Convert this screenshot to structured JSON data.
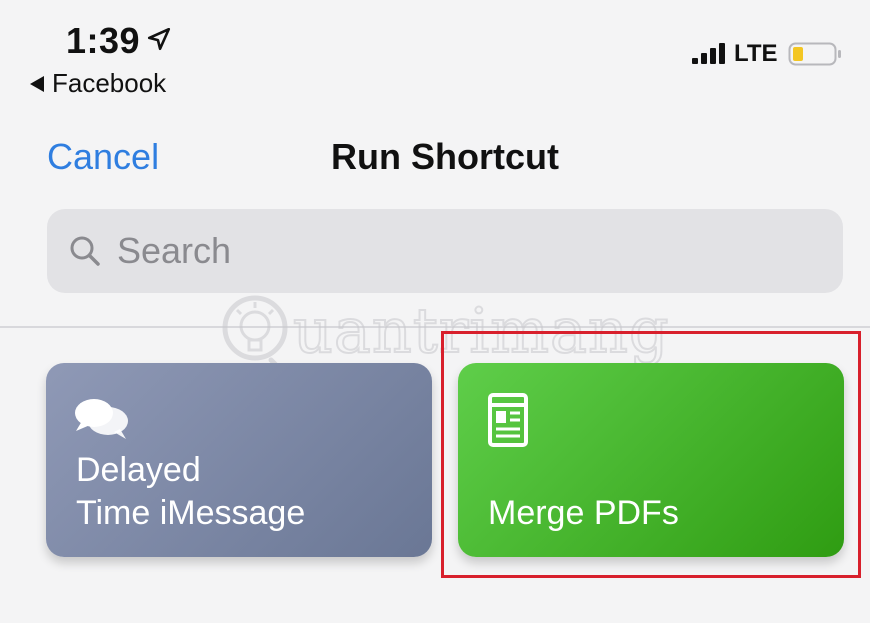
{
  "status_bar": {
    "time": "1:39",
    "back_app_label": "Facebook",
    "network": "LTE",
    "battery_color": "#f3c623"
  },
  "nav": {
    "cancel_label": "Cancel",
    "title": "Run Shortcut"
  },
  "search": {
    "placeholder": "Search"
  },
  "watermark": {
    "text": "uantrimang"
  },
  "shortcuts": [
    {
      "label_line1": "Delayed",
      "label_line2": "Time iMessage",
      "icon": "chat-bubbles-icon",
      "color": "#7b86a5"
    },
    {
      "label": "Merge PDFs",
      "icon": "document-icon",
      "color": "#45b52c"
    }
  ],
  "highlight": {
    "color": "#d8202c"
  },
  "accent_color": "#2f7ee0"
}
